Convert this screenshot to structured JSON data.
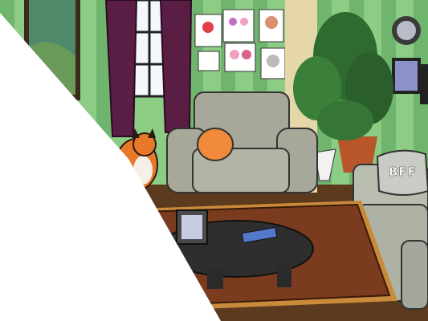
{
  "scene": {
    "pillow_text": "BFF"
  },
  "colors": {
    "wall_light": "#a9dca0",
    "wall_dark": "#6fb56e",
    "curtain": "#5a1e45",
    "armchair": "#a8a89a",
    "sofa": "#b9bdb0",
    "rug": "#7a3b1e",
    "rug_fringe": "#c98a3a",
    "table": "#2e2e2e",
    "floor": "#5c3a1e",
    "plant": "#2f6b2f",
    "fox": "#e8782a",
    "pillow_orange": "#f08a3a",
    "white_panel": "#ffffff"
  }
}
